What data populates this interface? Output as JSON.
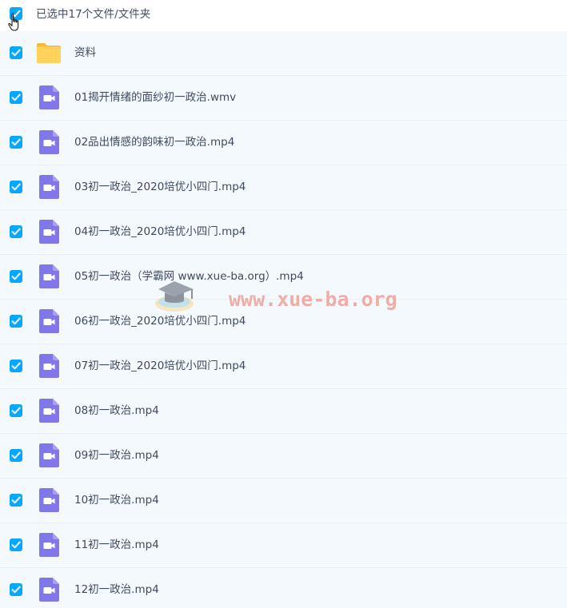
{
  "header": {
    "selection_label": "已选中17个文件/文件夹",
    "select_all_checked": true
  },
  "files": [
    {
      "name": "资料",
      "type": "folder",
      "checked": true
    },
    {
      "name": "01揭开情绪的面纱初一政治.wmv",
      "type": "video",
      "checked": true
    },
    {
      "name": "02品出情感的韵味初一政治.mp4",
      "type": "video",
      "checked": true
    },
    {
      "name": "03初一政治_2020培优小四门.mp4",
      "type": "video",
      "checked": true
    },
    {
      "name": "04初一政治_2020培优小四门.mp4",
      "type": "video",
      "checked": true
    },
    {
      "name": "05初一政治（学霸网 www.xue-ba.org）.mp4",
      "type": "video",
      "checked": true
    },
    {
      "name": "06初一政治_2020培优小四门.mp4",
      "type": "video",
      "checked": true
    },
    {
      "name": "07初一政治_2020培优小四门.mp4",
      "type": "video",
      "checked": true
    },
    {
      "name": "08初一政治.mp4",
      "type": "video",
      "checked": true
    },
    {
      "name": "09初一政治.mp4",
      "type": "video",
      "checked": true
    },
    {
      "name": "10初一政治.mp4",
      "type": "video",
      "checked": true
    },
    {
      "name": "11初一政治.mp4",
      "type": "video",
      "checked": true
    },
    {
      "name": "12初一政治.mp4",
      "type": "video",
      "checked": true
    }
  ],
  "watermark": {
    "text": "www.xue-ba.org"
  },
  "colors": {
    "checkbox": "#06a7ff",
    "folder": "#ffcf4a",
    "video": "#8078e9",
    "row_background": "#f4f9fd",
    "text": "#3d4a5f"
  },
  "icons": {
    "checkbox": "check-icon",
    "folder": "folder-icon",
    "video": "video-file-icon",
    "cursor": "hand-pointer-icon"
  }
}
